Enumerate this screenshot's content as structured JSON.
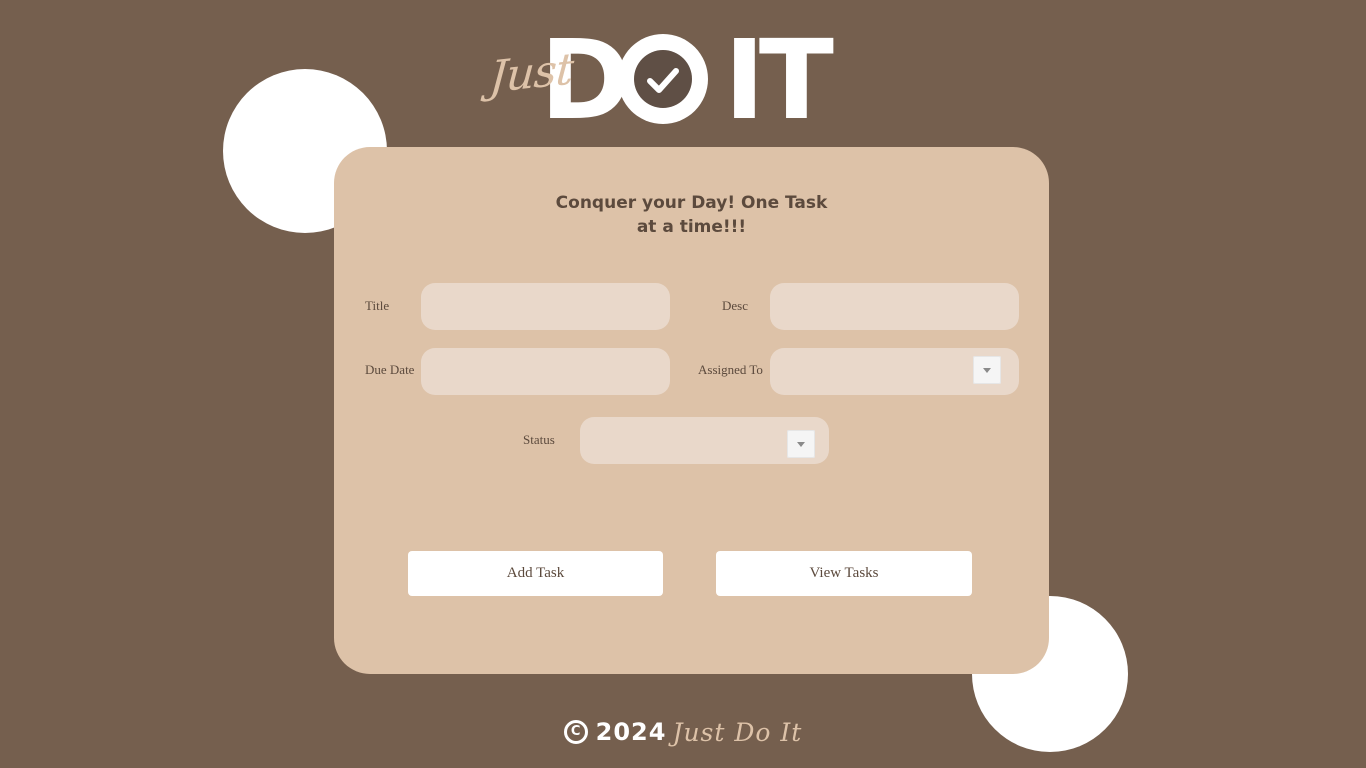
{
  "app": {
    "colors": {
      "background": "#755F4E",
      "card": "#DDC2A8",
      "field": "#E9D8CA",
      "text": "#5C4A3D",
      "accent": "#DDC2A8",
      "white": "#FFFFFF"
    }
  },
  "logo": {
    "script_text": "Just",
    "letter_d": "D",
    "letter_o_icon": "check-circle-icon",
    "letters_it": "IT"
  },
  "card": {
    "heading_line1": "Conquer your Day! One Task",
    "heading_line2": "at a time!!!"
  },
  "form": {
    "title_label": "Title",
    "title_value": "",
    "desc_label": "Desc",
    "desc_value": "",
    "due_date_label": "Due Date",
    "due_date_value": "",
    "assigned_to_label": "Assigned To",
    "assigned_to_value": "",
    "status_label": "Status",
    "status_value": ""
  },
  "actions": {
    "add_task_label": "Add Task",
    "view_tasks_label": "View Tasks"
  },
  "footer": {
    "copyright_symbol": "C",
    "year": "2024",
    "brand": "Just Do It"
  }
}
